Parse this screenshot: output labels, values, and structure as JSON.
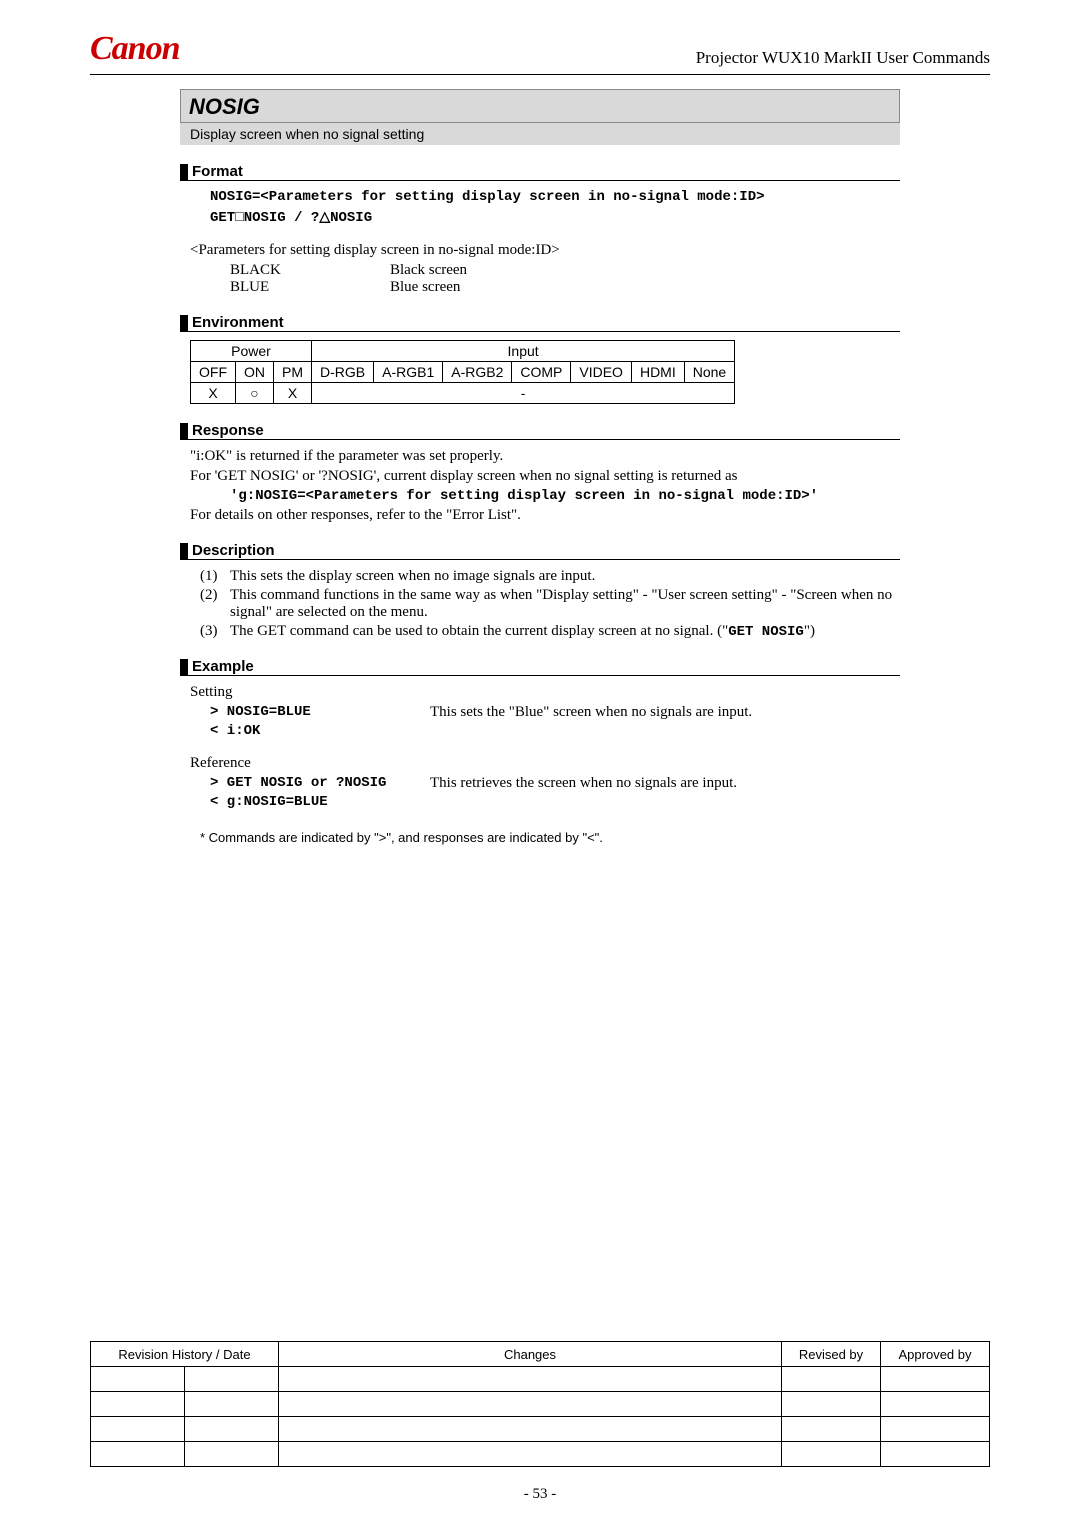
{
  "header": {
    "logo": "Canon",
    "doc_title": "Projector WUX10 MarkII User Commands"
  },
  "command": {
    "name": "NOSIG",
    "subtitle": "Display screen when no signal setting"
  },
  "format": {
    "heading": "Format",
    "line1": "NOSIG=<Parameters for setting display screen in no-signal mode:ID>",
    "line2_a": "GET",
    "line2_b": "NOSIG   /   ?",
    "line2_c": "NOSIG",
    "param_intro": "<Parameters for setting display screen in no-signal mode:ID>",
    "params": [
      {
        "key": "BLACK",
        "val": "Black screen"
      },
      {
        "key": "BLUE",
        "val": "Blue screen"
      }
    ]
  },
  "environment": {
    "heading": "Environment",
    "power_label": "Power",
    "input_label": "Input",
    "cols": [
      "OFF",
      "ON",
      "PM",
      "D-RGB",
      "A-RGB1",
      "A-RGB2",
      "COMP",
      "VIDEO",
      "HDMI",
      "None"
    ],
    "row": {
      "off": "X",
      "on": "○",
      "pm": "X",
      "input_dash": "-"
    }
  },
  "response": {
    "heading": "Response",
    "l1": "\"i:OK\" is returned if the parameter was set properly.",
    "l2": "For 'GET NOSIG' or '?NOSIG', current display screen when no signal setting is returned as",
    "l3": "'g:NOSIG=<Parameters for setting display screen in no-signal mode:ID>'",
    "l4": "For details on other responses, refer to the \"Error List\"."
  },
  "description": {
    "heading": "Description",
    "items": [
      {
        "n": "(1)",
        "t": "This sets the display screen when no image signals are input."
      },
      {
        "n": "(2)",
        "t": "This command functions in the same way as when \"Display setting\" - \"User screen setting\" - \"Screen when no signal\" are selected on the menu."
      },
      {
        "n": "(3)",
        "t_pre": "The GET command can be used to obtain the current display screen at no signal. (\"",
        "t_mono": "GET NOSIG",
        "t_post": "\")"
      }
    ]
  },
  "example": {
    "heading": "Example",
    "setting_label": "Setting",
    "set_cmd": "> NOSIG=BLUE",
    "set_desc": "This sets the \"Blue\" screen when no signals are input.",
    "set_resp": "< i:OK",
    "ref_label": "Reference",
    "ref_cmd": "> GET NOSIG or ?NOSIG",
    "ref_desc": "This retrieves the screen when no signals are input.",
    "ref_resp": "< g:NOSIG=BLUE",
    "footnote": "* Commands are indicated by \">\", and responses are indicated by \"<\"."
  },
  "revision": {
    "h1": "Revision History / Date",
    "h2": "Changes",
    "h3": "Revised by",
    "h4": "Approved by"
  },
  "page_number": "- 53 -"
}
